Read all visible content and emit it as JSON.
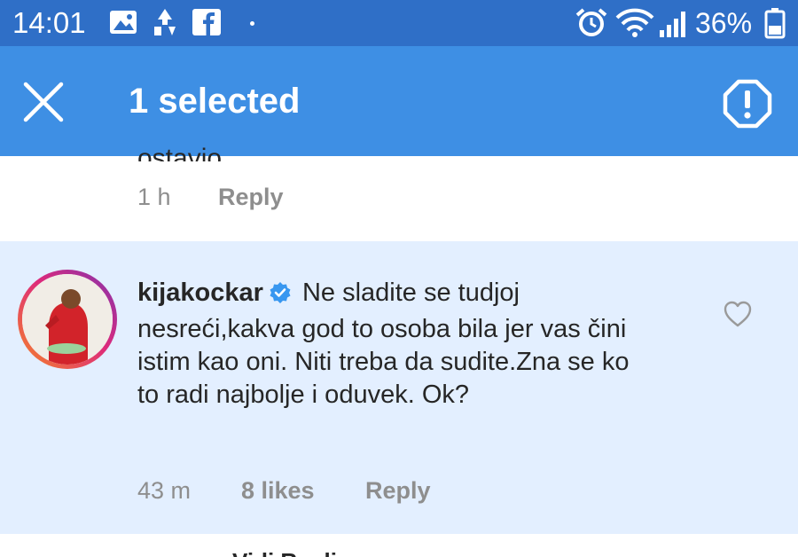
{
  "status_bar": {
    "time": "14:01",
    "battery_percent": "36%",
    "icons": [
      "gallery-icon",
      "recycle-icon",
      "facebook-icon",
      "alarm-icon",
      "wifi-icon",
      "signal-icon",
      "battery-icon"
    ]
  },
  "app_bar": {
    "title": "1 selected",
    "close_icon": "close-icon",
    "report_icon": "report-icon"
  },
  "comments": [
    {
      "text_cut": "ostavio.",
      "time": "1 h",
      "reply_label": "Reply"
    },
    {
      "username": "kijakockar",
      "verified": true,
      "text": "Ne sladite se tudjoj nesreći,kakva god to osoba bila jer vas čini istim kao oni. Niti treba da sudite.Zna se ko to radi najbolje i oduvek. Ok?",
      "time": "43 m",
      "likes": "8 likes",
      "reply_label": "Reply",
      "selected": true
    },
    {
      "text_cut": "Vidi Replies"
    }
  ],
  "colors": {
    "status_bar": "#2f6fc7",
    "app_bar": "#3e8fe4",
    "selected_bg": "#e3efff",
    "verified_blue": "#3897f0",
    "meta_gray": "#8e8e8e"
  }
}
